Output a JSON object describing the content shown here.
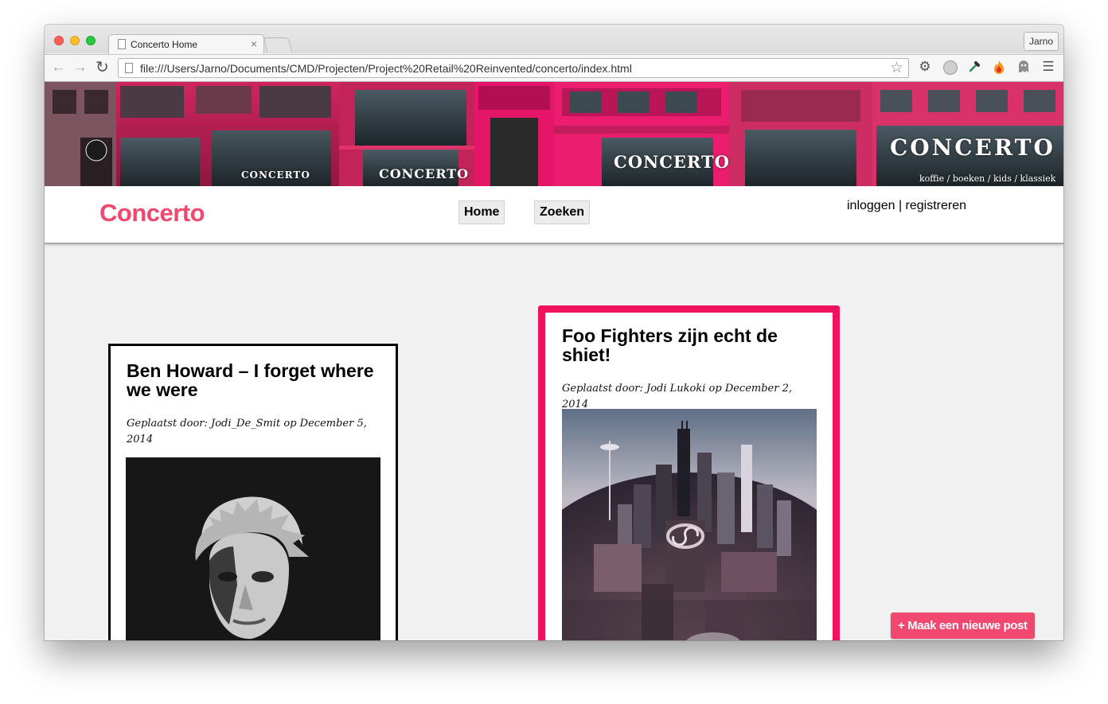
{
  "browser": {
    "tab_title": "Concerto Home",
    "tab_close": "×",
    "profile_name": "Jarno",
    "url": "file:///Users/Jarno/Documents/CMD/Projecten/Project%20Retail%20Reinvented/concerto/index.html",
    "icons": [
      "back-arrow-icon",
      "forward-arrow-icon",
      "reload-icon",
      "page-icon",
      "bookmark-star-icon",
      "gear-icon",
      "ghostery-icon",
      "eyedropper-icon",
      "fire-icon",
      "ghost-icon",
      "menu-icon"
    ]
  },
  "banner": {
    "signs": [
      "CONCERTO",
      "CONCERTO",
      "CONCERTO",
      "CONCERTO"
    ],
    "subtitle": "koffie / boeken / kids / klassiek"
  },
  "header": {
    "logo": "Concerto",
    "nav": {
      "home": "Home",
      "search": "Zoeken"
    },
    "login": "inloggen",
    "separator": " | ",
    "register": "registreren"
  },
  "posts": [
    {
      "title": "Ben Howard – I forget where we were",
      "meta": "Geplaatst door: Jodi_De_Smit op December 5, 2014",
      "image": "black-and-white portrait of a man"
    },
    {
      "title": "Foo Fighters zijn echt de shiet!",
      "meta": "Geplaatst door: Jodi Lukoki op December 2, 2014",
      "image": "fisheye aerial view of a city skyline"
    }
  ],
  "new_post_button": "+ Maak een nieuwe post",
  "colors": {
    "brand_pink": "#f2476f",
    "highlight_border": "#f0115f",
    "page_background": "#f1f1f1"
  }
}
